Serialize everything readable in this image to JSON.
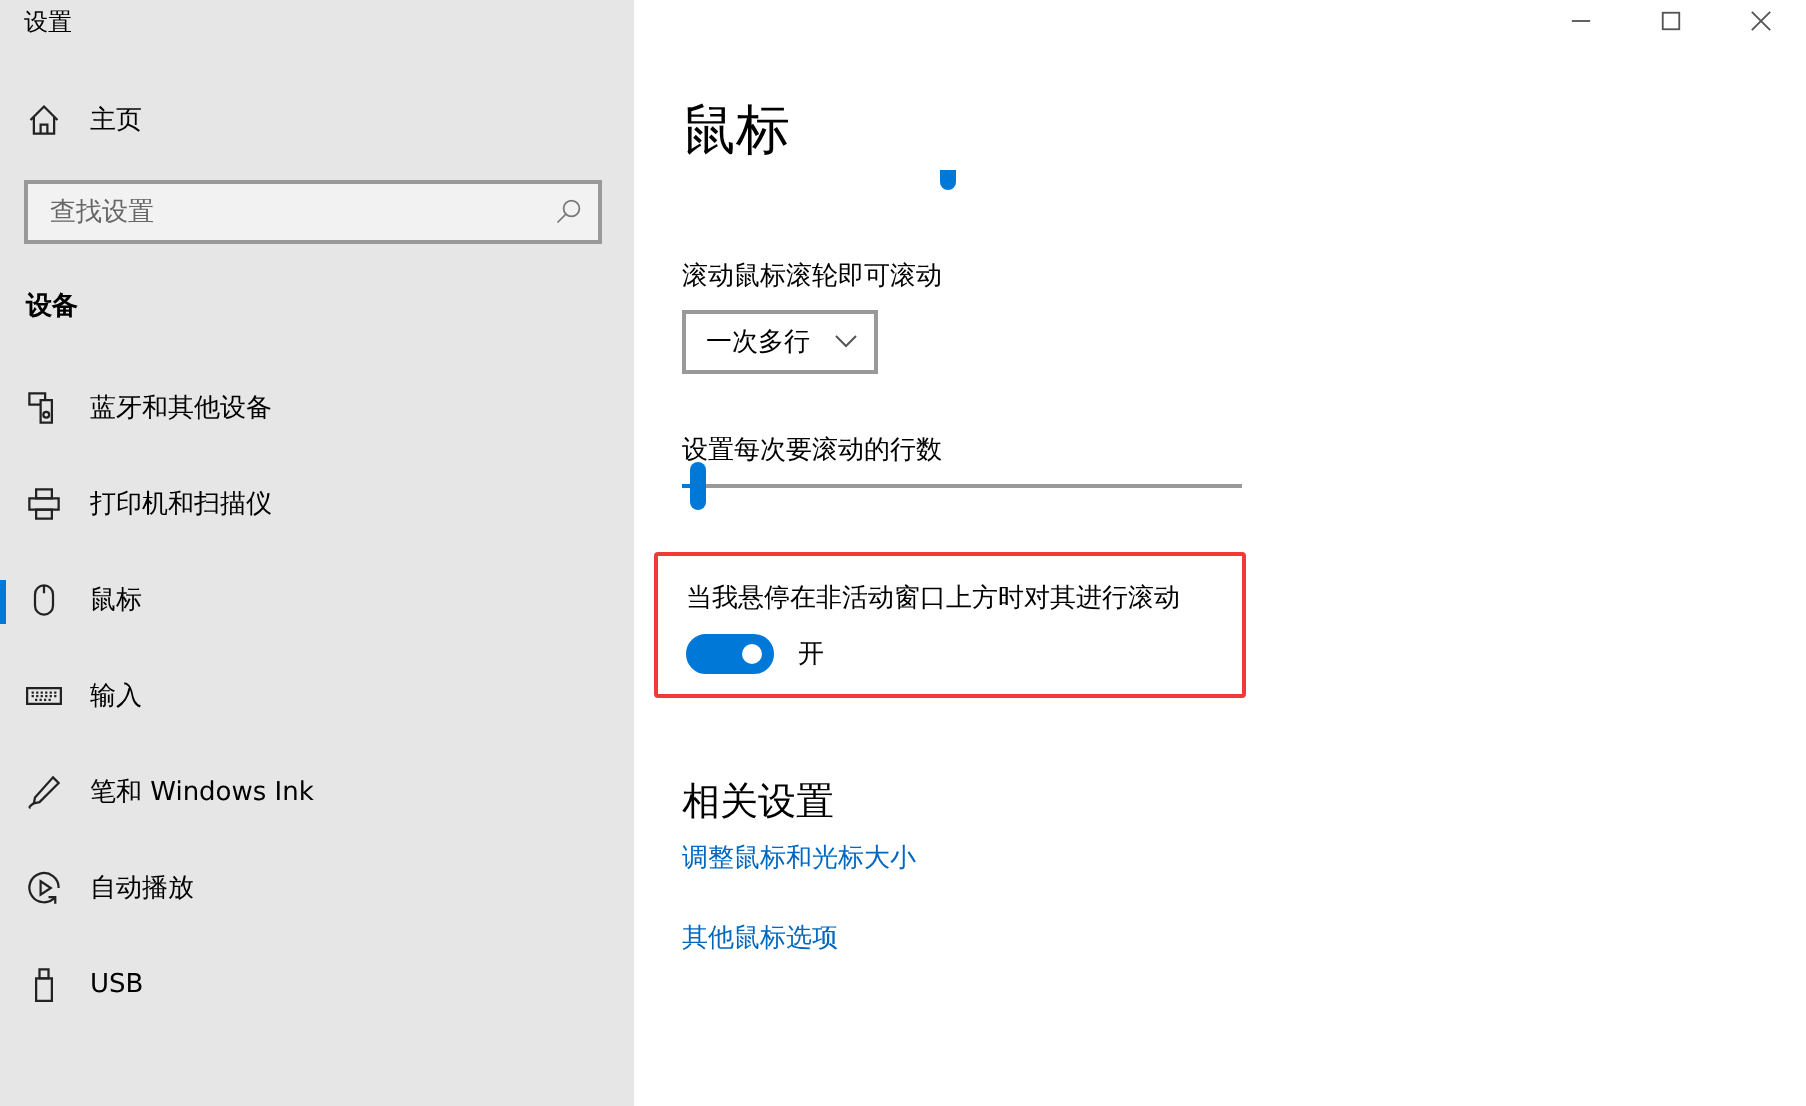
{
  "window": {
    "title": "设置"
  },
  "sidebar": {
    "home": "主页",
    "search": {
      "placeholder": "查找设置"
    },
    "section": "设备",
    "items": [
      {
        "label": "蓝牙和其他设备",
        "selected": false
      },
      {
        "label": "打印机和扫描仪",
        "selected": false
      },
      {
        "label": "鼠标",
        "selected": true
      },
      {
        "label": "输入",
        "selected": false
      },
      {
        "label": "笔和 Windows Ink",
        "selected": false
      },
      {
        "label": "自动播放",
        "selected": false
      },
      {
        "label": "USB",
        "selected": false
      }
    ]
  },
  "main": {
    "title": "鼠标",
    "scroll_label": "滚动鼠标滚轮即可滚动",
    "scroll_dropdown": "一次多行",
    "lines_label": "设置每次要滚动的行数",
    "lines_slider": {
      "level": 0.03
    },
    "inactive_scroll": {
      "label": "当我悬停在非活动窗口上方时对其进行滚动",
      "on": true,
      "state_text": "开",
      "highlighted": true
    },
    "related_heading": "相关设置",
    "links": [
      "调整鼠标和光标大小",
      "其他鼠标选项"
    ]
  }
}
